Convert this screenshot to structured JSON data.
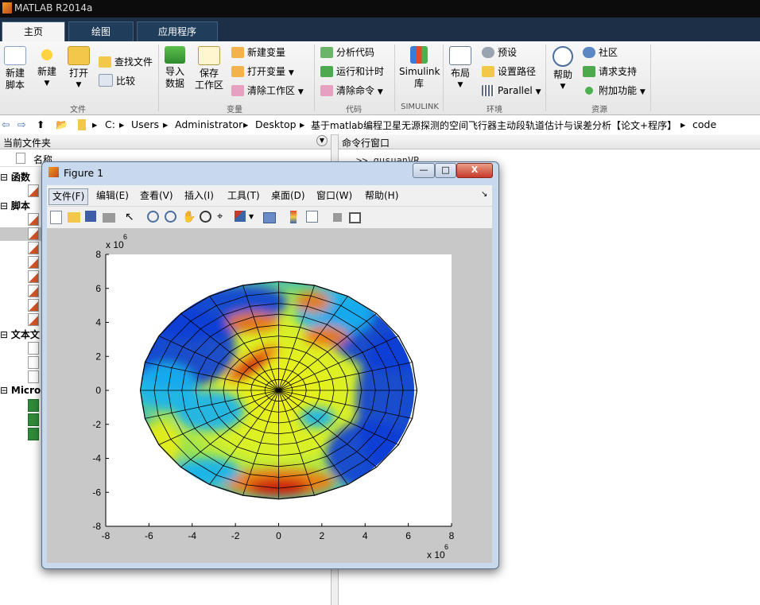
{
  "window": {
    "title": "MATLAB R2014a"
  },
  "tabs": [
    {
      "label": "主页",
      "active": true
    },
    {
      "label": "绘图"
    },
    {
      "label": "应用程序"
    }
  ],
  "ribbon": {
    "file": {
      "new_script": [
        "新建",
        "脚本"
      ],
      "new": "新建",
      "open": "打开",
      "find_files": "查找文件",
      "compare": "比较",
      "group": "文件"
    },
    "variable": {
      "import": [
        "导入",
        "数据"
      ],
      "save": [
        "保存",
        "工作区"
      ],
      "new_var": "新建变量",
      "open_var": "打开变量",
      "clear_ws": "清除工作区",
      "group": "变量"
    },
    "code": {
      "analyze": "分析代码",
      "run_time": "运行和计时",
      "clear_cmd": "清除命令",
      "group": "代码"
    },
    "simulink": {
      "label": [
        "Simulink",
        "库"
      ],
      "group": "SIMULINK"
    },
    "env": {
      "layout": "布局",
      "prefs": "预设",
      "set_path": "设置路径",
      "parallel": "Parallel",
      "group": "环境"
    },
    "resources": {
      "help": "帮助",
      "community": "社区",
      "support": "请求支持",
      "addons": "附加功能",
      "group": "资源"
    }
  },
  "address": {
    "path": [
      "C:",
      "Users",
      "Administrator",
      "Desktop",
      "基于matlab编程卫星无源探测的空间飞行器主动段轨道估计与误差分析【论文+程序】",
      "code"
    ]
  },
  "left_panel": {
    "title": "当前文件夹",
    "col_name": "名称",
    "groups": [
      "函数",
      "脚本",
      "文本文",
      "Micro"
    ]
  },
  "right_panel": {
    "title": "命令行窗口",
    "cmd_text": ">> gusuanVR"
  },
  "figure": {
    "title": "Figure 1",
    "menu": [
      "文件(F)",
      "编辑(E)",
      "查看(V)",
      "插入(I)",
      "工具(T)",
      "桌面(D)",
      "窗口(W)",
      "帮助(H)"
    ],
    "min_label": "—",
    "max_label": "□",
    "close_label": "X"
  },
  "chart_data": {
    "type": "heatmap",
    "title": "",
    "xlabel": "",
    "ylabel": "",
    "xlim": [
      -8,
      8
    ],
    "ylim": [
      -8,
      8
    ],
    "x_ticks": [
      "-8",
      "-6",
      "-4",
      "-2",
      "0",
      "2",
      "4",
      "6",
      "8"
    ],
    "y_ticks": [
      "-8",
      "-6",
      "-4",
      "-2",
      "0",
      "2",
      "4",
      "6",
      "8"
    ],
    "x_exponent": "x 10",
    "x_exponent_power": "6",
    "y_exponent": "x 10",
    "y_exponent_power": "6",
    "surface": {
      "shape": "ellipse",
      "x_radius": 6.4,
      "y_radius": 6.4,
      "rings": 10,
      "spokes": 24
    },
    "colormap": "jet",
    "colors": {
      "blue": "#0a3fd6",
      "cyan": "#16b2f0",
      "yellow": "#e8ee18",
      "orange": "#f07a10",
      "red": "#c8120c"
    }
  }
}
